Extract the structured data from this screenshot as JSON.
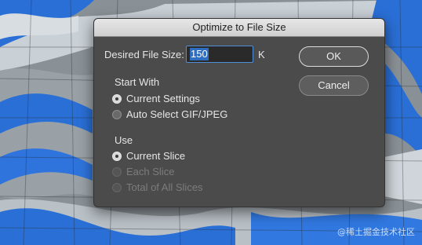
{
  "dialog": {
    "title": "Optimize to File Size",
    "file_size_label": "Desired File Size:",
    "file_size_value": "150",
    "file_size_unit": "K",
    "ok_label": "OK",
    "cancel_label": "Cancel",
    "start_with": {
      "heading": "Start With",
      "options": [
        {
          "label": "Current Settings",
          "selected": true,
          "enabled": true
        },
        {
          "label": "Auto Select GIF/JPEG",
          "selected": false,
          "enabled": true
        }
      ]
    },
    "use": {
      "heading": "Use",
      "options": [
        {
          "label": "Current Slice",
          "selected": true,
          "enabled": true
        },
        {
          "label": "Each Slice",
          "selected": false,
          "enabled": false
        },
        {
          "label": "Total of All Slices",
          "selected": false,
          "enabled": false
        }
      ]
    }
  },
  "watermark": "@稀土掘金技术社区",
  "colors": {
    "dialog_bg": "#4b4b4b",
    "accent_blue": "#2f6dbe",
    "backdrop_blue": "#2a6fd6"
  }
}
